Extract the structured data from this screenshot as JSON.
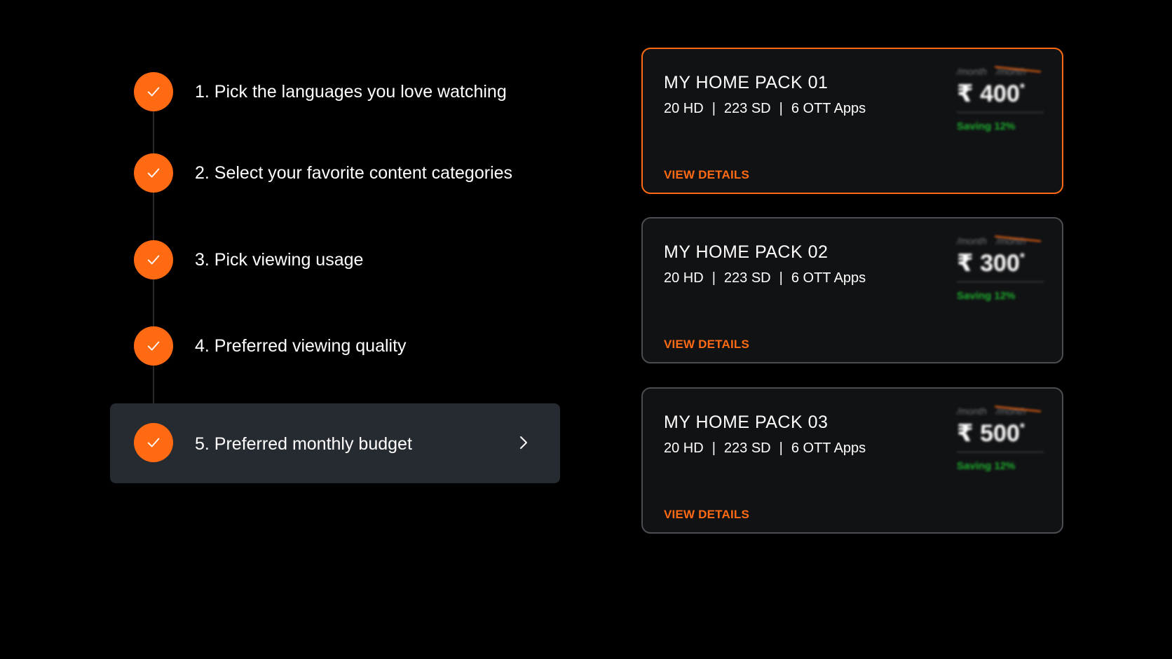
{
  "colors": {
    "background": "#000000",
    "accent": "#ff6a13",
    "active_step_bg": "#262a31",
    "card_border": "#4a4d52",
    "saving_green": "#1fae2f"
  },
  "steps": [
    {
      "label": "1. Pick the languages you love watching",
      "completed": true,
      "icon": "check-icon"
    },
    {
      "label": "2. Select your favorite content categories",
      "completed": true,
      "icon": "check-icon"
    },
    {
      "label": "3. Pick viewing usage",
      "completed": true,
      "icon": "check-icon"
    },
    {
      "label": "4. Preferred viewing quality",
      "completed": true,
      "icon": "check-icon"
    },
    {
      "label": "5. Preferred monthly budget",
      "completed": true,
      "active": true,
      "icon": "check-icon",
      "trailing_icon": "chevron-right-icon"
    }
  ],
  "packs": [
    {
      "name": "MY HOME PACK 01",
      "hd": "20 HD",
      "sd": "223 SD",
      "ott": "6 OTT Apps",
      "separator": "|",
      "period": "/month",
      "old_price": "/month",
      "price": "₹ 400",
      "price_mark": "*",
      "saving": "Saving 12%",
      "cta": "VIEW DETAILS",
      "selected": true
    },
    {
      "name": "MY HOME PACK 02",
      "hd": "20 HD",
      "sd": "223 SD",
      "ott": "6 OTT Apps",
      "separator": "|",
      "period": "/month",
      "old_price": "/month",
      "price": "₹ 300",
      "price_mark": "*",
      "saving": "Saving 12%",
      "cta": "VIEW DETAILS",
      "selected": false
    },
    {
      "name": "MY HOME PACK 03",
      "hd": "20 HD",
      "sd": "223 SD",
      "ott": "6 OTT Apps",
      "separator": "|",
      "period": "/month",
      "old_price": "/month",
      "price": "₹ 500",
      "price_mark": "*",
      "saving": "Saving 12%",
      "cta": "VIEW DETAILS",
      "selected": false
    }
  ]
}
